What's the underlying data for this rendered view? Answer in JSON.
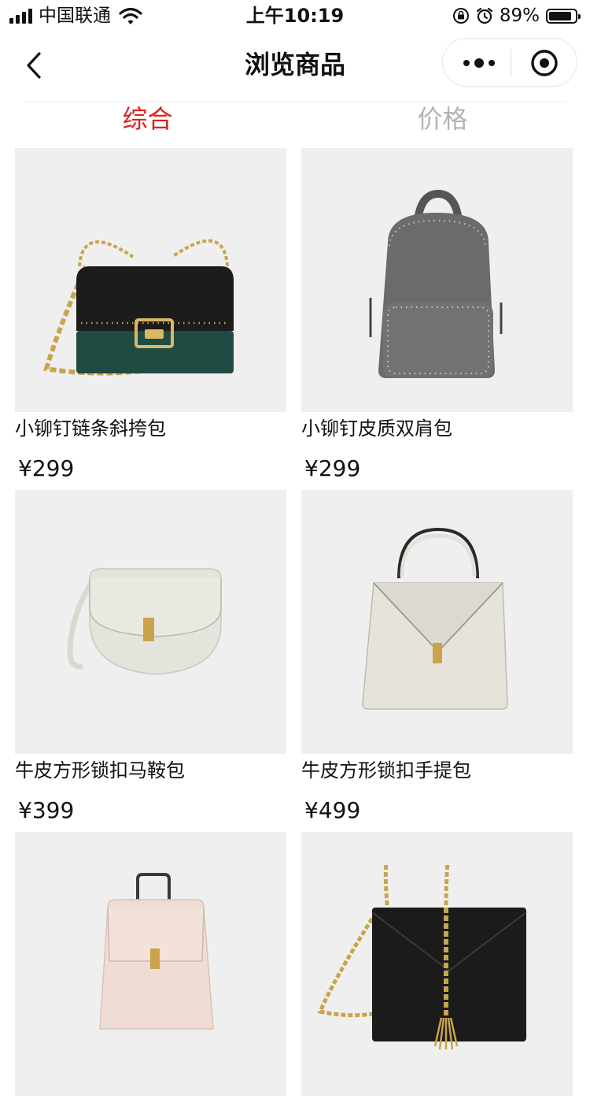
{
  "status": {
    "carrier": "中国联通",
    "time": "上午10:19",
    "battery_pct_text": "89%",
    "battery_level": 0.89
  },
  "nav": {
    "title": "浏览商品"
  },
  "tabs": [
    {
      "label": "综合",
      "active": true
    },
    {
      "label": "价格",
      "active": false
    }
  ],
  "colors": {
    "accent": "#e0201e",
    "tab_inactive": "#b3b3b3",
    "card_bg": "#efefef"
  },
  "icons": {
    "back": "chevron-left-icon",
    "more": "more-dots-icon",
    "target": "target-circle-icon"
  },
  "products": [
    {
      "name": "小铆钉链条斜挎包",
      "price": "¥299"
    },
    {
      "name": "小铆钉皮质双肩包",
      "price": "¥299"
    },
    {
      "name": "牛皮方形锁扣马鞍包",
      "price": "¥399"
    },
    {
      "name": "牛皮方形锁扣手提包",
      "price": "¥499"
    },
    {
      "name": "",
      "price": ""
    },
    {
      "name": "",
      "price": ""
    }
  ]
}
